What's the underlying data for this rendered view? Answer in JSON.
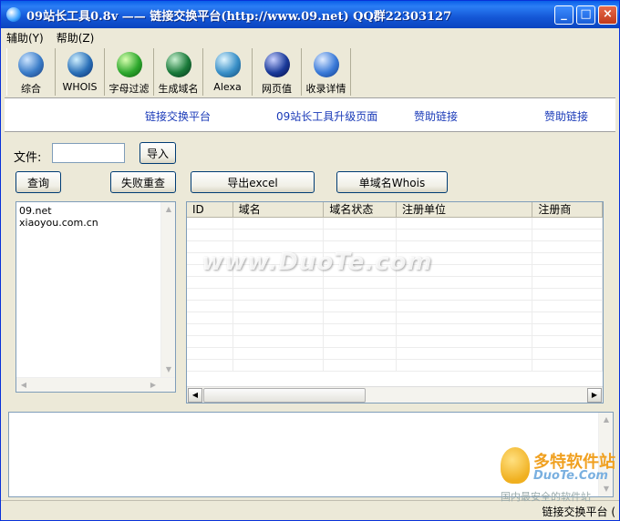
{
  "window": {
    "title": "09站长工具0.8v —— 链接交换平台(http://www.09.net)  QQ群22303127",
    "min_label": "_",
    "max_label": "□",
    "close_label": "×"
  },
  "menu": [
    "辅助(Y)",
    "帮助(Z)"
  ],
  "toolbar": {
    "items": [
      {
        "label": "综合",
        "icon": "globe-icon",
        "color": "#3a7cc8"
      },
      {
        "label": "WHOIS",
        "icon": "earth-icon",
        "color": "#2a70b8"
      },
      {
        "label": "字母过滤",
        "icon": "filter-icon",
        "color": "#2ea82e"
      },
      {
        "label": "生成域名",
        "icon": "generate-icon",
        "color": "#1a7a3a"
      },
      {
        "label": "Alexa",
        "icon": "alexa-icon",
        "color": "#3a90c8"
      },
      {
        "label": "网页值",
        "icon": "pagerank-icon",
        "color": "#1a3a9a"
      },
      {
        "label": "收录详情",
        "icon": "index-icon",
        "color": "#3a7ad8"
      }
    ]
  },
  "banner": {
    "links": [
      "链接交换平台",
      "09站长工具升级页面",
      "赞助链接",
      "赞助链接"
    ]
  },
  "controls": {
    "file_label": "文件:",
    "file_value": "",
    "import_button": "导入",
    "query_button": "查询",
    "retry_button": "失败重查",
    "export_button": "导出excel",
    "whois_button": "单域名Whois"
  },
  "domain_list": [
    "09.net",
    "xiaoyou.com.cn"
  ],
  "grid": {
    "columns": [
      "ID",
      "域名",
      "域名状态",
      "注册单位",
      "注册商"
    ],
    "rows": []
  },
  "watermark": "www.DuoTe.com",
  "logo": {
    "main": "多特软件站",
    "sub": "DuoTe.Com",
    "cn": "国内最安全的软件站"
  },
  "status": {
    "text": "链接交换平台 ("
  }
}
